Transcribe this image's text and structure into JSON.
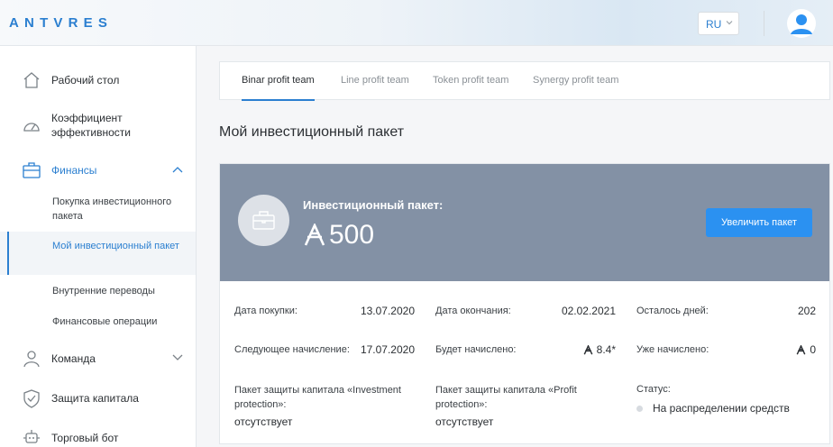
{
  "header": {
    "logo": "ANTVRES",
    "lang": "RU"
  },
  "sidebar": {
    "items": [
      {
        "label": "Рабочий стол"
      },
      {
        "label": "Коэффициент эффективности"
      },
      {
        "label": "Финансы"
      },
      {
        "label": "Команда"
      },
      {
        "label": "Защита капитала"
      },
      {
        "label": "Торговый бот"
      }
    ],
    "finance_sub": [
      {
        "label": "Покупка инвестиционного пакета"
      },
      {
        "label": "Мой инвестиционный пакет"
      },
      {
        "label": "Внутренние переводы"
      },
      {
        "label": "Финансовые операции"
      }
    ]
  },
  "tabs": [
    {
      "label": "Binar profit team"
    },
    {
      "label": "Line profit team"
    },
    {
      "label": "Token profit team"
    },
    {
      "label": "Synergy profit team"
    }
  ],
  "page_title": "Мой инвестиционный пакет",
  "package": {
    "label": "Инвестиционный пакет:",
    "amount": "500",
    "increase_button": "Увеличить пакет"
  },
  "details": {
    "purchase_date_label": "Дата покупки:",
    "purchase_date": "13.07.2020",
    "end_date_label": "Дата окончания:",
    "end_date": "02.02.2021",
    "days_left_label": "Осталось дней:",
    "days_left": "202",
    "next_accrual_label": "Следующее начисление:",
    "next_accrual": "17.07.2020",
    "will_accrue_label": "Будет начислено:",
    "will_accrue": "8.4*",
    "accrued_label": "Уже начислено:",
    "accrued": "0",
    "invest_protection_label": "Пакет защиты капитала «Investment protection»:",
    "invest_protection_value": "отсутствует",
    "profit_protection_label": "Пакет защиты капитала «Profit protection»:",
    "profit_protection_value": "отсутствует",
    "status_label": "Статус:",
    "status_value": "На распределении средств"
  },
  "colors": {
    "accent": "#2b7fd0",
    "button": "#2b91f1",
    "card_header": "#8391a5"
  }
}
